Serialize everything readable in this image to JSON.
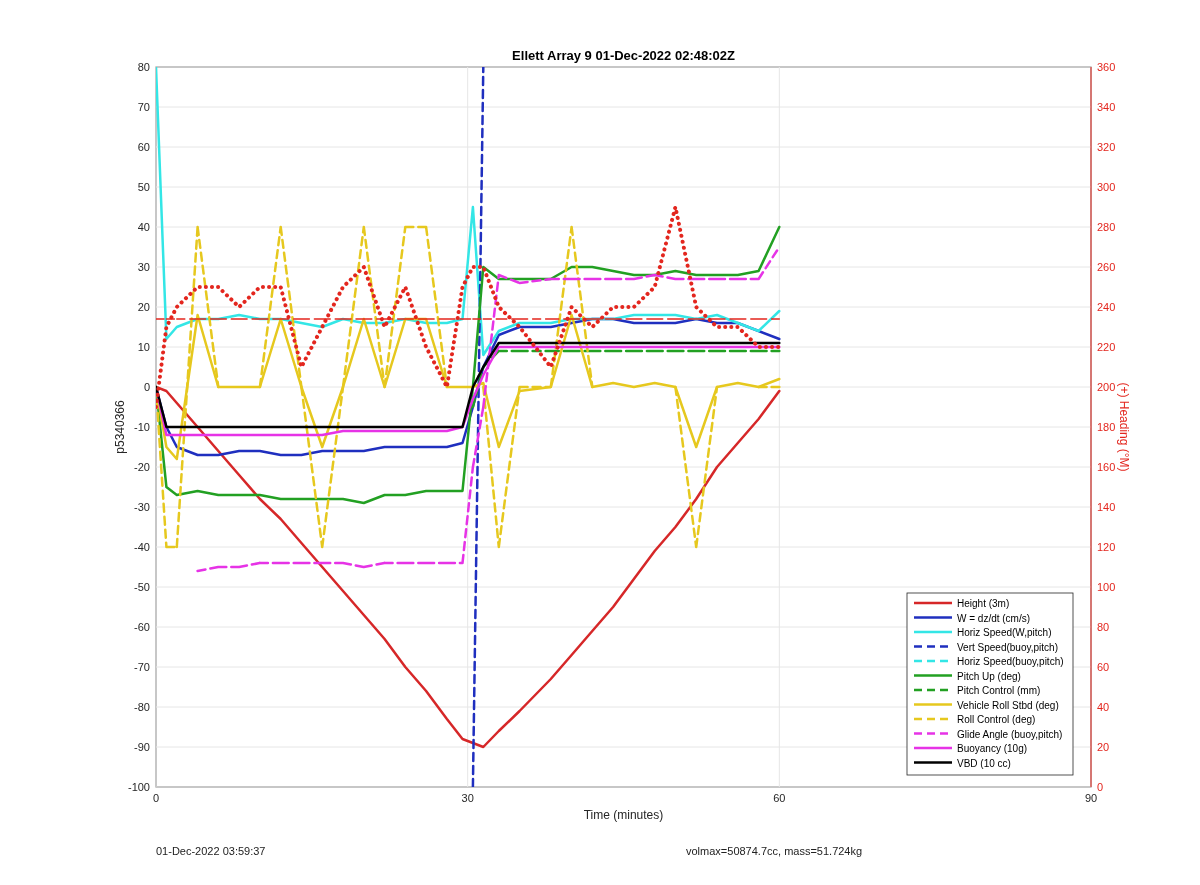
{
  "figure": {
    "chart_data": {
      "type": "line",
      "title": "Ellett Array 9 01-Dec-2022 02:48:02Z",
      "xlabel": "Time (minutes)",
      "ylabel": "p5340366",
      "y2label": "(+) Heading (°M)",
      "xlim": [
        0,
        90
      ],
      "ylim": [
        -100,
        80
      ],
      "y2lim": [
        0,
        360
      ],
      "xticks": [
        0,
        30,
        60,
        90
      ],
      "yticks": [
        -100,
        -90,
        -80,
        -70,
        -60,
        -50,
        -40,
        -30,
        -20,
        -10,
        0,
        10,
        20,
        30,
        40,
        50,
        60,
        70,
        80
      ],
      "y2ticks": [
        0,
        20,
        40,
        60,
        80,
        100,
        120,
        140,
        160,
        180,
        200,
        220,
        240,
        260,
        280,
        300,
        320,
        340,
        360
      ],
      "x": [
        0,
        1,
        2,
        4,
        6,
        8,
        10,
        12,
        14,
        16,
        18,
        20,
        22,
        24,
        26,
        28,
        29.5,
        30.5,
        31.5,
        33,
        35,
        38,
        40,
        42,
        44,
        46,
        48,
        50,
        52,
        54,
        56,
        58,
        60
      ],
      "series": [
        {
          "name": "Height (3m)",
          "color": "#d62728",
          "line_style": "solid",
          "values": [
            0,
            -1,
            -4,
            -10,
            -16,
            -22,
            -28,
            -33,
            -39,
            -45,
            -51,
            -57,
            -63,
            -70,
            -76,
            -83,
            -88,
            -89,
            -90,
            -86,
            -81,
            -73,
            -67,
            -61,
            -55,
            -48,
            -41,
            -35,
            -28,
            -20,
            -14,
            -8,
            -1
          ]
        },
        {
          "name": "W = dz/dt (cm/s)",
          "color": "#1f2fbf",
          "line_style": "solid",
          "values": [
            0,
            -10,
            -15,
            -17,
            -17,
            -16,
            -16,
            -17,
            -17,
            -16,
            -16,
            -16,
            -15,
            -15,
            -15,
            -15,
            -14,
            -5,
            5,
            13,
            15,
            15,
            16,
            17,
            17,
            16,
            16,
            16,
            17,
            16,
            16,
            14,
            12
          ]
        },
        {
          "name": "Horiz Speed(W,pitch)",
          "color": "#33e6e6",
          "line_style": "solid",
          "values": [
            80,
            12,
            15,
            17,
            17,
            18,
            17,
            17,
            16,
            15,
            17,
            16,
            16,
            17,
            16,
            16,
            17,
            45,
            8,
            14,
            16,
            16,
            17,
            17,
            17,
            18,
            18,
            18,
            17,
            18,
            16,
            14,
            19
          ]
        },
        {
          "name": "Vert Speed(buoy,pitch)",
          "color": "#1f2fbf",
          "line_style": "dashed",
          "values": [
            null,
            null,
            null,
            null,
            null,
            null,
            null,
            null,
            null,
            null,
            null,
            null,
            null,
            null,
            null,
            null,
            null,
            -100,
            80,
            null,
            null,
            null,
            null,
            null,
            null,
            null,
            null,
            null,
            null,
            null,
            null,
            null,
            null
          ]
        },
        {
          "name": "Horiz Speed(buoy,pitch)",
          "color": "#33e6e6",
          "line_style": "dashed",
          "values": [
            null,
            null,
            null,
            null,
            null,
            null,
            null,
            null,
            null,
            null,
            null,
            null,
            null,
            null,
            null,
            null,
            null,
            null,
            null,
            null,
            null,
            null,
            null,
            null,
            null,
            null,
            null,
            null,
            null,
            null,
            null,
            null,
            null
          ]
        },
        {
          "name": "Pitch Up (deg)",
          "color": "#22a022",
          "line_style": "solid",
          "values": [
            0,
            -25,
            -27,
            -26,
            -27,
            -27,
            -27,
            -28,
            -28,
            -28,
            -28,
            -29,
            -27,
            -27,
            -26,
            -26,
            -26,
            0,
            30,
            27,
            27,
            27,
            30,
            30,
            29,
            28,
            28,
            29,
            28,
            28,
            28,
            29,
            40
          ]
        },
        {
          "name": "Pitch Control (mm)",
          "color": "#22a022",
          "line_style": "dashed",
          "values": [
            null,
            null,
            null,
            null,
            null,
            null,
            null,
            null,
            null,
            null,
            null,
            null,
            null,
            null,
            null,
            null,
            null,
            -5,
            5,
            9,
            9,
            9,
            9,
            9,
            9,
            9,
            9,
            9,
            9,
            9,
            9,
            9,
            9
          ]
        },
        {
          "name": "Vehicle Roll Stbd (deg)",
          "color": "#e6c81e",
          "line_style": "solid",
          "values": [
            0,
            -15,
            -18,
            18,
            0,
            0,
            0,
            17,
            0,
            -15,
            0,
            17,
            0,
            17,
            17,
            0,
            0,
            0,
            1,
            -15,
            -1,
            0,
            18,
            0,
            1,
            0,
            1,
            0,
            -15,
            0,
            1,
            0,
            2
          ]
        },
        {
          "name": "Roll Control (deg)",
          "color": "#e6c81e",
          "line_style": "dashed",
          "values": [
            0,
            -40,
            -40,
            40,
            0,
            null,
            0,
            40,
            0,
            -40,
            0,
            40,
            0,
            40,
            40,
            0,
            null,
            null,
            0,
            -40,
            0,
            0,
            40,
            0,
            null,
            null,
            null,
            0,
            -40,
            0,
            null,
            0,
            0
          ]
        },
        {
          "name": "Glide Angle (buoy,pitch)",
          "color": "#e633e6",
          "line_style": "dashed",
          "values": [
            null,
            null,
            null,
            -46,
            -45,
            -45,
            -44,
            -44,
            -44,
            -44,
            -44,
            -45,
            -44,
            -44,
            -44,
            -44,
            -44,
            -20,
            -5,
            28,
            26,
            27,
            27,
            27,
            27,
            27,
            28,
            27,
            27,
            27,
            27,
            27,
            35
          ]
        },
        {
          "name": "Buoyancy (10g)",
          "color": "#e633e6",
          "line_style": "solid",
          "values": [
            0,
            -12,
            -12,
            -12,
            -12,
            -12,
            -12,
            -12,
            -12,
            -12,
            -11,
            -11,
            -11,
            -11,
            -11,
            -11,
            -10,
            -3,
            3,
            10,
            10,
            10,
            10,
            10,
            10,
            10,
            10,
            10,
            10,
            10,
            10,
            10,
            10
          ]
        },
        {
          "name": "VBD (10 cc)",
          "color": "#000000",
          "line_style": "solid",
          "values": [
            0,
            -10,
            -10,
            -10,
            -10,
            -10,
            -10,
            -10,
            -10,
            -10,
            -10,
            -10,
            -10,
            -10,
            -10,
            -10,
            -10,
            0,
            5,
            11,
            11,
            11,
            11,
            11,
            11,
            11,
            11,
            11,
            11,
            11,
            11,
            11,
            11
          ]
        },
        {
          "color": "#e3261e",
          "line_style": "dashed",
          "values": [
            17,
            17,
            17,
            17,
            17,
            17,
            17,
            17,
            17,
            17,
            17,
            17,
            17,
            17,
            17,
            17,
            17,
            17,
            17,
            17,
            17,
            17,
            17,
            17,
            17,
            17,
            17,
            17,
            17,
            17,
            17,
            17,
            17
          ]
        },
        {
          "color": "#e3261e",
          "line_style": "dotted",
          "axis": "y2",
          "values": [
            190,
            230,
            240,
            250,
            250,
            240,
            250,
            250,
            210,
            230,
            250,
            260,
            230,
            250,
            220,
            200,
            250,
            260,
            260,
            240,
            230,
            210,
            240,
            230,
            240,
            240,
            250,
            290,
            240,
            230,
            230,
            220,
            220
          ]
        }
      ],
      "grid": true,
      "legend": true
    },
    "footer": {
      "timestamp": "01-Dec-2022 03:59:37",
      "info": "volmax=50874.7cc, mass=51.724kg"
    }
  }
}
